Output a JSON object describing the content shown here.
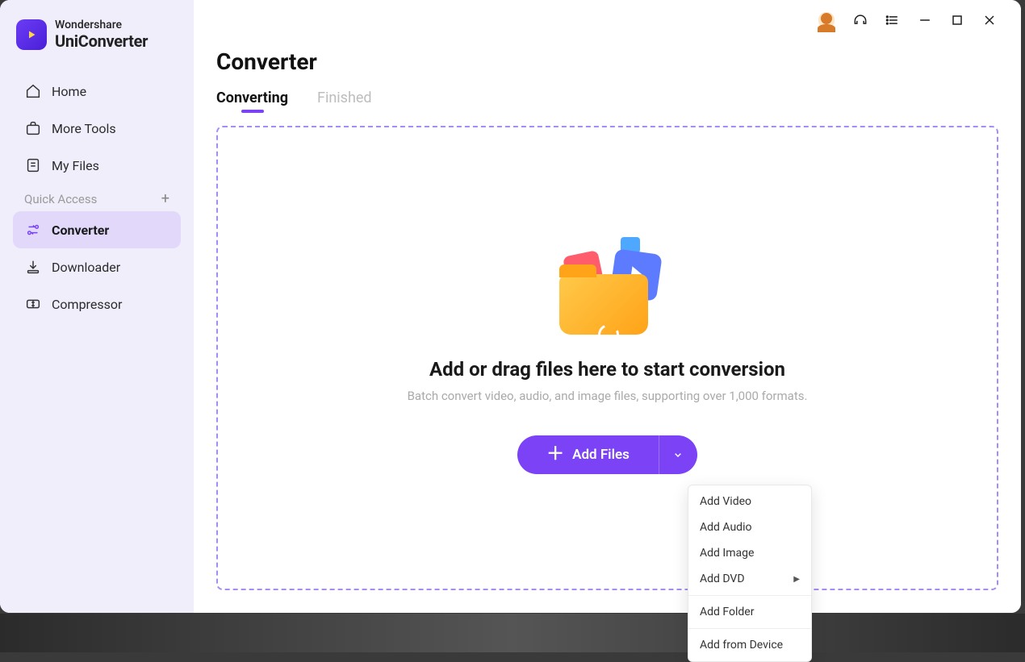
{
  "brand": {
    "line1": "Wondershare",
    "line2": "UniConverter"
  },
  "sidebar": {
    "items": [
      {
        "label": "Home",
        "icon": "home"
      },
      {
        "label": "More Tools",
        "icon": "briefcase"
      },
      {
        "label": "My Files",
        "icon": "file"
      }
    ],
    "sectionLabel": "Quick Access",
    "quick": [
      {
        "label": "Converter",
        "icon": "converter",
        "active": true
      },
      {
        "label": "Downloader",
        "icon": "download"
      },
      {
        "label": "Compressor",
        "icon": "compress"
      }
    ]
  },
  "page": {
    "title": "Converter",
    "tabs": {
      "converting": "Converting",
      "finished": "Finished"
    },
    "dropzone": {
      "heading": "Add or drag files here to start conversion",
      "sub": "Batch convert video, audio, and image files, supporting over 1,000 formats.",
      "button": "Add Files"
    }
  },
  "menu": {
    "addVideo": "Add Video",
    "addAudio": "Add Audio",
    "addImage": "Add Image",
    "addDVD": "Add DVD",
    "addFolder": "Add Folder",
    "addFromDevice": "Add from Device"
  }
}
